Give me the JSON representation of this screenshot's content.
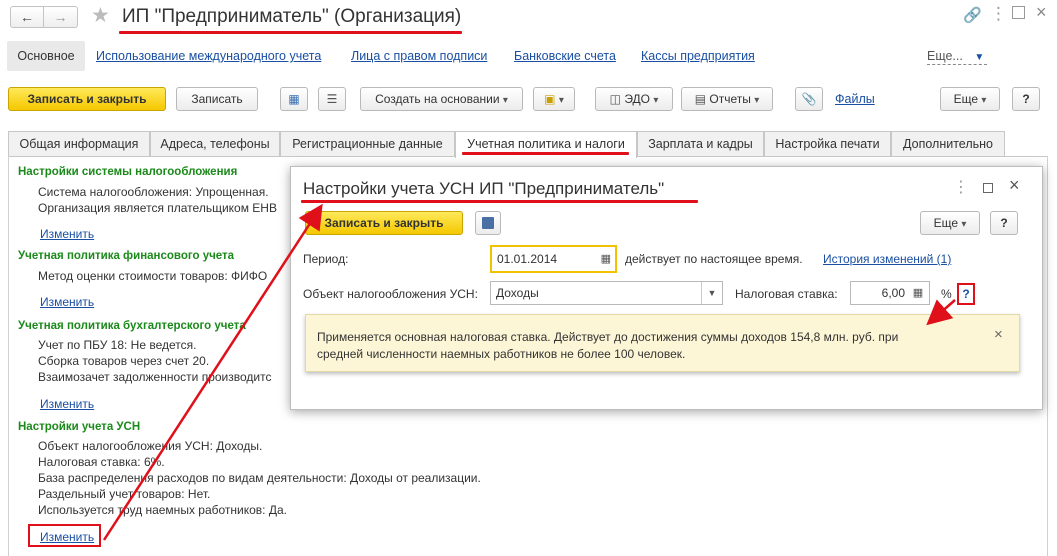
{
  "window": {
    "title": "ИП \"Предприниматель\" (Организация)"
  },
  "navbar": {
    "main": "Основное",
    "links": [
      "Использование международного учета",
      "Лица с правом подписи",
      "Банковские счета",
      "Кассы предприятия"
    ],
    "more": "Еще..."
  },
  "toolbar": {
    "save_close": "Записать и закрыть",
    "save": "Записать",
    "create_based": "Создать на основании",
    "edo": "ЭДО",
    "reports": "Отчеты",
    "files": "Файлы",
    "more": "Еще",
    "help": "?"
  },
  "tabs": [
    "Общая информация",
    "Адреса, телефоны",
    "Регистрационные данные",
    "Учетная политика и налоги",
    "Зарплата и кадры",
    "Настройка печати",
    "Дополнительно"
  ],
  "sections": [
    {
      "header": "Настройки системы налогообложения",
      "lines": [
        "Система налогообложения: Упрощенная.",
        "Организация является плательщиком ЕНВ"
      ],
      "link": "Изменить"
    },
    {
      "header": "Учетная политика финансового учета",
      "lines": [
        "Метод оценки стоимости товаров: ФИФО"
      ],
      "link": "Изменить"
    },
    {
      "header": "Учетная политика бухгалтерского учета",
      "lines": [
        "Учет по ПБУ 18: Не ведется.",
        "Сборка товаров через счет 20.",
        "Взаимозачет задолженности производитс"
      ],
      "link": "Изменить"
    },
    {
      "header": "Настройки учета УСН",
      "lines": [
        "Объект налогообложения УСН: Доходы.",
        "Налоговая ставка: 6%.",
        "База распределения расходов по видам деятельности: Доходы от реализации.",
        "Раздельный учет товаров: Нет.",
        "Используется труд наемных работников: Да."
      ],
      "link": "Изменить"
    }
  ],
  "dialog": {
    "title": "Настройки учета УСН ИП \"Предприниматель\"",
    "save_close": "Записать и закрыть",
    "more": "Еще",
    "help": "?",
    "period_label": "Период:",
    "period_value": "01.01.2014",
    "valid_text": "действует по настоящее время.",
    "history_link": "История изменений (1)",
    "object_label": "Объект налогообложения УСН:",
    "object_value": "Доходы",
    "rate_label": "Налоговая ставка:",
    "rate_value": "6,00",
    "percent": "%",
    "rate_help": "?",
    "info_line1": "Применяется основная налоговая ставка. Действует до достижения суммы доходов 154,8 млн. руб. при",
    "info_line2": "средней численности наемных работников не более 100 человек.",
    "close_info": "×"
  },
  "colors": {
    "accent_yellow": "#f5c800",
    "link_blue": "#1a4fa3",
    "section_green": "#1b8a1b",
    "annotation_red": "#e0101a",
    "info_bg": "#fdf6d6"
  }
}
